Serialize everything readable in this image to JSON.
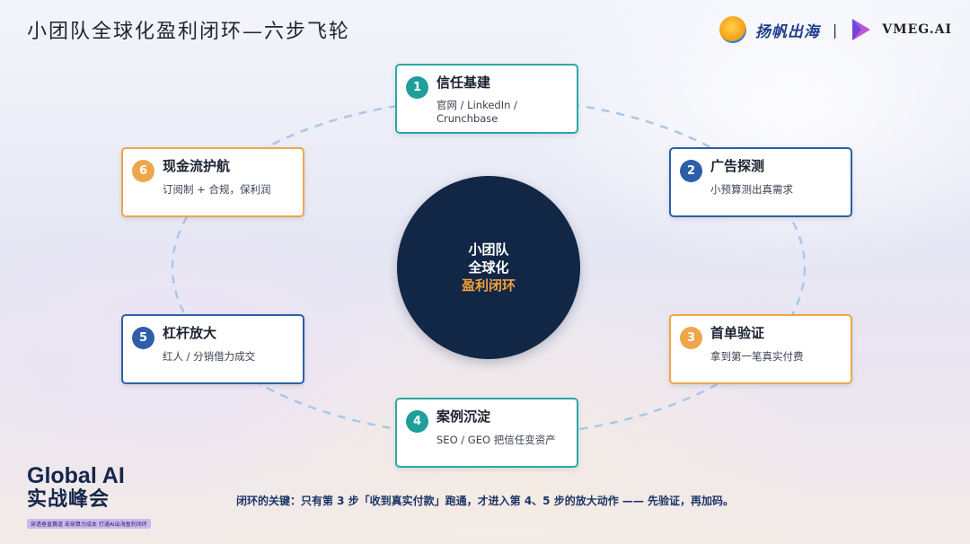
{
  "title": "小团队全球化盈利闭环—六步飞轮",
  "brand": {
    "name": "扬帆出海",
    "separator": "|",
    "partner": "VMEG.AI"
  },
  "center": {
    "line1": "小团队",
    "line2": "全球化",
    "line3": "盈利闭环"
  },
  "steps": [
    {
      "num": "1",
      "title": "信任基建",
      "desc": "官网 / LinkedIn / Crunchbase",
      "color": "teal"
    },
    {
      "num": "2",
      "title": "广告探测",
      "desc": "小预算测出真需求",
      "color": "blue"
    },
    {
      "num": "3",
      "title": "首单验证",
      "desc": "拿到第一笔真实付费",
      "color": "orange"
    },
    {
      "num": "4",
      "title": "案例沉淀",
      "desc": "SEO / GEO 把信任变资产",
      "color": "teal"
    },
    {
      "num": "5",
      "title": "杠杆放大",
      "desc": "红人 / 分销借力成交",
      "color": "blue"
    },
    {
      "num": "6",
      "title": "现金流护航",
      "desc": "订阅制 + 合规，保利润",
      "color": "orange"
    }
  ],
  "note": "闭环的关键：只有第 3 步「收到真实付款」跑通，才进入第 4、5 步的放大动作 —— 先验证，再加码。",
  "summit": {
    "line1": "Global AI",
    "line2": "实战峰会",
    "tagline": "穿透垂直赛道 击穿算力成本 打通AI出海盈利闭环"
  },
  "colors": {
    "teal": "#1f9e9a",
    "blue": "#2d5fa8",
    "orange": "#eea64a",
    "center_bg": "#122646",
    "center_highlight": "#f0a13a"
  }
}
